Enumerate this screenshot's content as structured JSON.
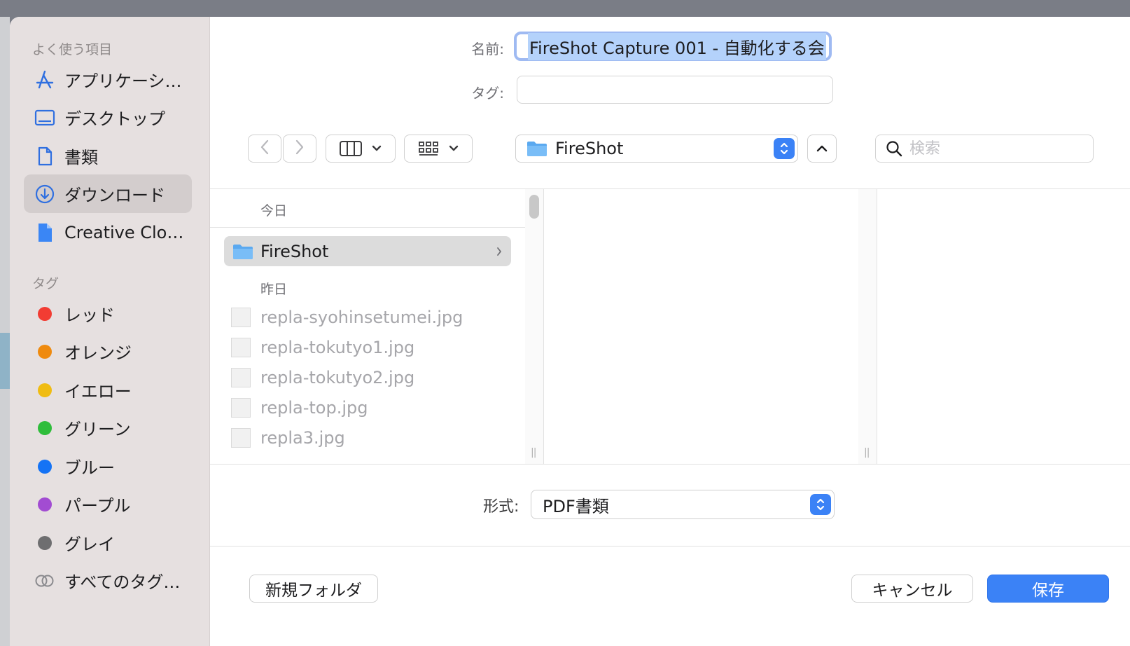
{
  "sidebar": {
    "favorites_heading": "よく使う項目",
    "favorites": [
      {
        "label": "アプリケーシ…",
        "icon": "applications-icon"
      },
      {
        "label": "デスクトップ",
        "icon": "desktop-icon"
      },
      {
        "label": "書類",
        "icon": "document-icon"
      },
      {
        "label": "ダウンロード",
        "icon": "download-icon",
        "active": true
      },
      {
        "label": "Creative Clo…",
        "icon": "cloud-file-icon"
      }
    ],
    "tags_heading": "タグ",
    "tags": [
      {
        "label": "レッド",
        "color": "#f23c33"
      },
      {
        "label": "オレンジ",
        "color": "#ef8a0e"
      },
      {
        "label": "イエロー",
        "color": "#f0bc12"
      },
      {
        "label": "グリーン",
        "color": "#2fbd3b"
      },
      {
        "label": "ブルー",
        "color": "#1573f5"
      },
      {
        "label": "パープル",
        "color": "#a24cd2"
      },
      {
        "label": "グレイ",
        "color": "#6e6e70"
      },
      {
        "label": "すべてのタグ…",
        "color": ""
      }
    ]
  },
  "form": {
    "name_label": "名前:",
    "name_value": "FireShot Capture 001 - 自動化する会",
    "tags_label": "タグ:"
  },
  "toolbar": {
    "location": "FireShot",
    "search_placeholder": "検索"
  },
  "browser": {
    "today_heading": "今日",
    "folder": "FireShot",
    "yesterday_heading": "昨日",
    "files": [
      "repla-syohinsetumei.jpg",
      "repla-tokutyo1.jpg",
      "repla-tokutyo2.jpg",
      "repla-top.jpg",
      "repla3.jpg"
    ]
  },
  "format": {
    "label": "形式:",
    "value": "PDF書類"
  },
  "buttons": {
    "new_folder": "新規フォルダ",
    "cancel": "キャンセル",
    "save": "保存"
  },
  "colors": {
    "accent": "#3b82f6",
    "selection": "#b4d2fb"
  }
}
